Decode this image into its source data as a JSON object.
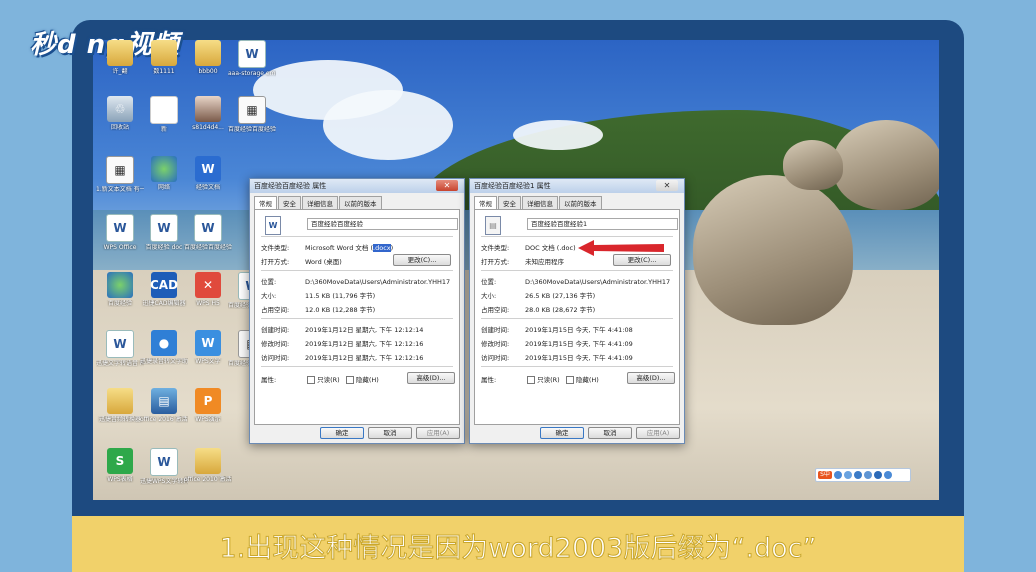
{
  "logo": {
    "text": "秒d ng视频"
  },
  "desktop_icons": [
    {
      "label": "许_翻",
      "kind": "folder"
    },
    {
      "label": "数1111",
      "kind": "folder"
    },
    {
      "label": "bbb00",
      "kind": "folder"
    },
    {
      "label": "aaa-storage emulated 0...",
      "kind": "word"
    },
    {
      "label": "回收站",
      "kind": "recycle"
    },
    {
      "label": "新",
      "kind": "blank"
    },
    {
      "label": "s81d4d4...",
      "kind": "photo"
    },
    {
      "label": "百度经验百度经验",
      "kind": "calc"
    },
    {
      "label": "1.新文本文档 有一些共用...",
      "kind": "calc"
    },
    {
      "label": "网络",
      "kind": "globe"
    },
    {
      "label": "经验文档",
      "kind": "wps"
    },
    {
      "label": "WPS Office",
      "kind": "word"
    },
    {
      "label": "百度经验 doc",
      "kind": "word"
    },
    {
      "label": "百度经验百度经验",
      "kind": "word"
    },
    {
      "label": "百度经验",
      "kind": "globe"
    },
    {
      "label": "迅捷CAD编辑器",
      "kind": "cad"
    },
    {
      "label": "WPS H5",
      "kind": "red"
    },
    {
      "label": "百度经验百度经验",
      "kind": "word"
    },
    {
      "label": "迅捷文字转语音 Pro...",
      "kind": "word"
    },
    {
      "label": "迅捷录音转文字助手",
      "kind": "mic"
    },
    {
      "label": "WPS文字",
      "kind": "blue"
    },
    {
      "label": "百度经验百度经验",
      "kind": "calc"
    },
    {
      "label": "迅捷音频转换器",
      "kind": "folder"
    },
    {
      "label": "office 2016 激活工具",
      "kind": "winrar"
    },
    {
      "label": "WPS演示",
      "kind": "orange"
    },
    {
      "label": "WPS表格",
      "kind": "green"
    },
    {
      "label": "迅捷WPS文字转PDF",
      "kind": "word"
    },
    {
      "label": "office 2010 激活工具",
      "kind": "folder"
    }
  ],
  "dialog1": {
    "title": "百度经验百度经验 属性",
    "tabs": [
      "常规",
      "安全",
      "详细信息",
      "以前的版本"
    ],
    "filename": "百度经验百度经验",
    "type_label": "文件类型:",
    "type_value": "Microsoft Word 文档 (",
    "type_ext": ".docx",
    "type_close": ")",
    "open_label": "打开方式:",
    "open_value": "Word (桌面)",
    "change_btn": "更改(C)...",
    "location_label": "位置:",
    "location_value": "D:\\360MoveData\\Users\\Administrator.YHH17",
    "size_label": "大小:",
    "size_value": "11.5 KB (11,796 字节)",
    "disk_label": "占用空间:",
    "disk_value": "12.0 KB (12,288 字节)",
    "created_label": "创建时间:",
    "created_value": "2019年1月12日 星期六, 下午 12:12:14",
    "modified_label": "修改时间:",
    "modified_value": "2019年1月12日 星期六, 下午 12:12:16",
    "accessed_label": "访问时间:",
    "accessed_value": "2019年1月12日 星期六, 下午 12:12:16",
    "attr_label": "属性:",
    "readonly": "只读(R)",
    "hidden": "隐藏(H)",
    "advanced_btn": "高级(D)...",
    "ok": "确定",
    "cancel": "取消",
    "apply": "应用(A)"
  },
  "dialog2": {
    "title": "百度经验百度经验1 属性",
    "tabs": [
      "常规",
      "安全",
      "详细信息",
      "以前的版本"
    ],
    "filename": "百度经验百度经验1",
    "type_label": "文件类型:",
    "type_value": "DOC 文档 (.doc)",
    "open_label": "打开方式:",
    "open_value": "未知应用程序",
    "change_btn": "更改(C)...",
    "location_label": "位置:",
    "location_value": "D:\\360MoveData\\Users\\Administrator.YHH17",
    "size_label": "大小:",
    "size_value": "26.5 KB (27,136 字节)",
    "disk_label": "占用空间:",
    "disk_value": "28.0 KB (28,672 字节)",
    "created_label": "创建时间:",
    "created_value": "2019年1月15日 今天, 下午 4:41:08",
    "modified_label": "修改时间:",
    "modified_value": "2019年1月15日 今天, 下午 4:41:09",
    "accessed_label": "访问时间:",
    "accessed_value": "2019年1月15日 今天, 下午 4:41:09",
    "attr_label": "属性:",
    "readonly": "只读(R)",
    "hidden": "隐藏(H)",
    "advanced_btn": "高级(D)...",
    "ok": "确定",
    "cancel": "取消",
    "apply": "应用(A)"
  },
  "tray": {
    "text": "S中"
  },
  "caption": {
    "text": "1.出现这种情况是因为word2003版后缀为“.doc”"
  },
  "colors": {
    "frame": "#1d4a80",
    "caption_bar": "#f1d16a",
    "arrow": "#d9262c",
    "highlight": "#3266cc"
  }
}
